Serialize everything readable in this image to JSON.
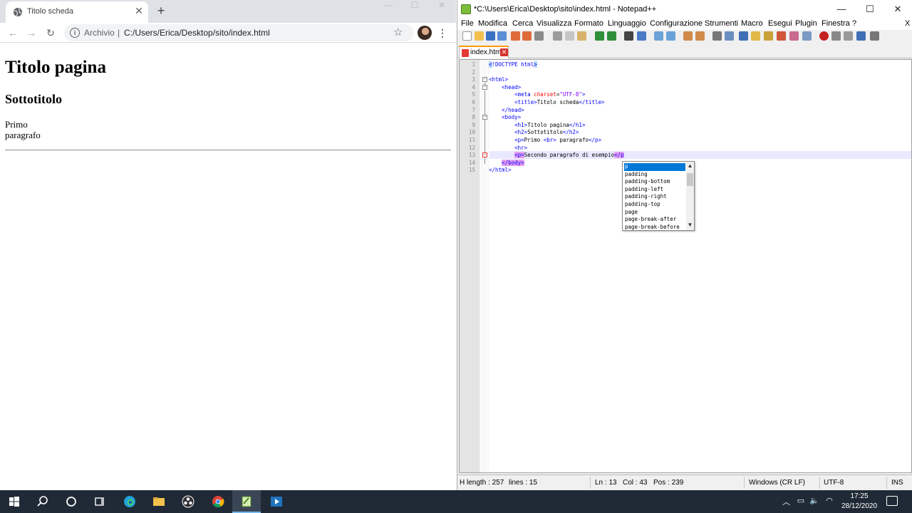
{
  "browser": {
    "tab_title": "Titolo scheda",
    "tab_close": "✕",
    "new_tab": "+",
    "address_prefix": "Archivio",
    "address_separator": "|",
    "address_url": "C:/Users/Erica/Desktop/sito/index.html",
    "page": {
      "h1": "Titolo pagina",
      "h2": "Sottotitolo",
      "p1_line1": "Primo",
      "p1_line2": "paragrafo"
    }
  },
  "editor": {
    "title": "*C:\\Users\\Erica\\Desktop\\sito\\index.html - Notepad++",
    "menu": [
      "File",
      "Modifica",
      "Cerca",
      "Visualizza",
      "Formato",
      "Linguaggio",
      "Configurazione",
      "Strumenti",
      "Macro",
      "Esegui",
      "Plugin",
      "Finestra",
      "?"
    ],
    "menu_close": "X",
    "tab_name": "index.html",
    "lines": [
      {
        "n": "1"
      },
      {
        "n": "2"
      },
      {
        "n": "3"
      },
      {
        "n": "4"
      },
      {
        "n": "5"
      },
      {
        "n": "6"
      },
      {
        "n": "7"
      },
      {
        "n": "8"
      },
      {
        "n": "9"
      },
      {
        "n": "10"
      },
      {
        "n": "11"
      },
      {
        "n": "12"
      },
      {
        "n": "13"
      },
      {
        "n": "14"
      },
      {
        "n": "15"
      }
    ],
    "autocomplete": [
      "p",
      "padding",
      "padding-bottom",
      "padding-left",
      "padding-right",
      "padding-top",
      "page",
      "page-break-after",
      "page-break-before"
    ],
    "status": {
      "length": "H length : 257",
      "lines": "lines : 15",
      "ln": "Ln : 13",
      "col": "Col : 43",
      "pos": "Pos : 239",
      "eol": "Windows (CR LF)",
      "encoding": "UTF-8",
      "mode": "INS"
    }
  },
  "taskbar": {
    "time": "17:25",
    "date": "28/12/2020"
  },
  "colors": {
    "tag": "#0000ff",
    "attribute": "#ff0000",
    "attr_value": "#8000ff",
    "taskbar": "#202a36",
    "autocomplete_selection": "#0078d7"
  }
}
